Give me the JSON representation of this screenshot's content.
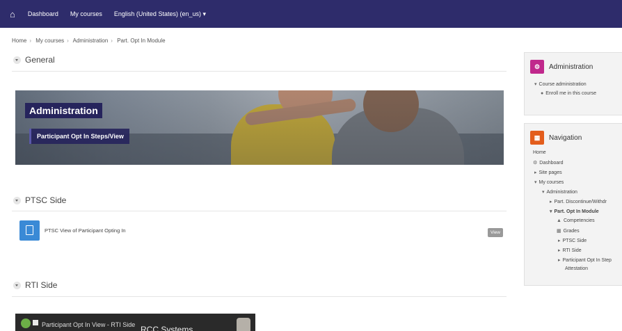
{
  "topbar": {
    "home_icon": "home-icon",
    "links": [
      "Dashboard",
      "My courses"
    ],
    "language": "English (United States) (en_us) ▾"
  },
  "breadcrumb": [
    "Home",
    "My courses",
    "Administration",
    "Part. Opt In Module"
  ],
  "sections": {
    "general": "General",
    "ptsc": "PTSC Side",
    "rti": "RTI Side"
  },
  "banner": {
    "title": "Administration",
    "subtitle": "Participant Opt In Steps/View"
  },
  "activity": {
    "name": "PTSC View of Participant Opting In",
    "button": "View",
    "icon": "document-icon"
  },
  "video": {
    "title_a": "Participant Opt In View - RTI Side",
    "title_b": "RCC Systems"
  },
  "admin_block": {
    "title": "Administration",
    "items": [
      "Course administration",
      "Enroll me in this course"
    ],
    "color": "#c0288c"
  },
  "nav_block": {
    "title": "Navigation",
    "color": "#e35d1c",
    "items": [
      "Home",
      "Dashboard",
      "Site pages",
      "My courses",
      "Administration",
      "Part. Discontinue/Withdr",
      "Part. Opt In Module",
      "Competencies",
      "Grades",
      "PTSC Side",
      "RTI Side",
      "Participant Opt In Step",
      "Attestation"
    ]
  }
}
